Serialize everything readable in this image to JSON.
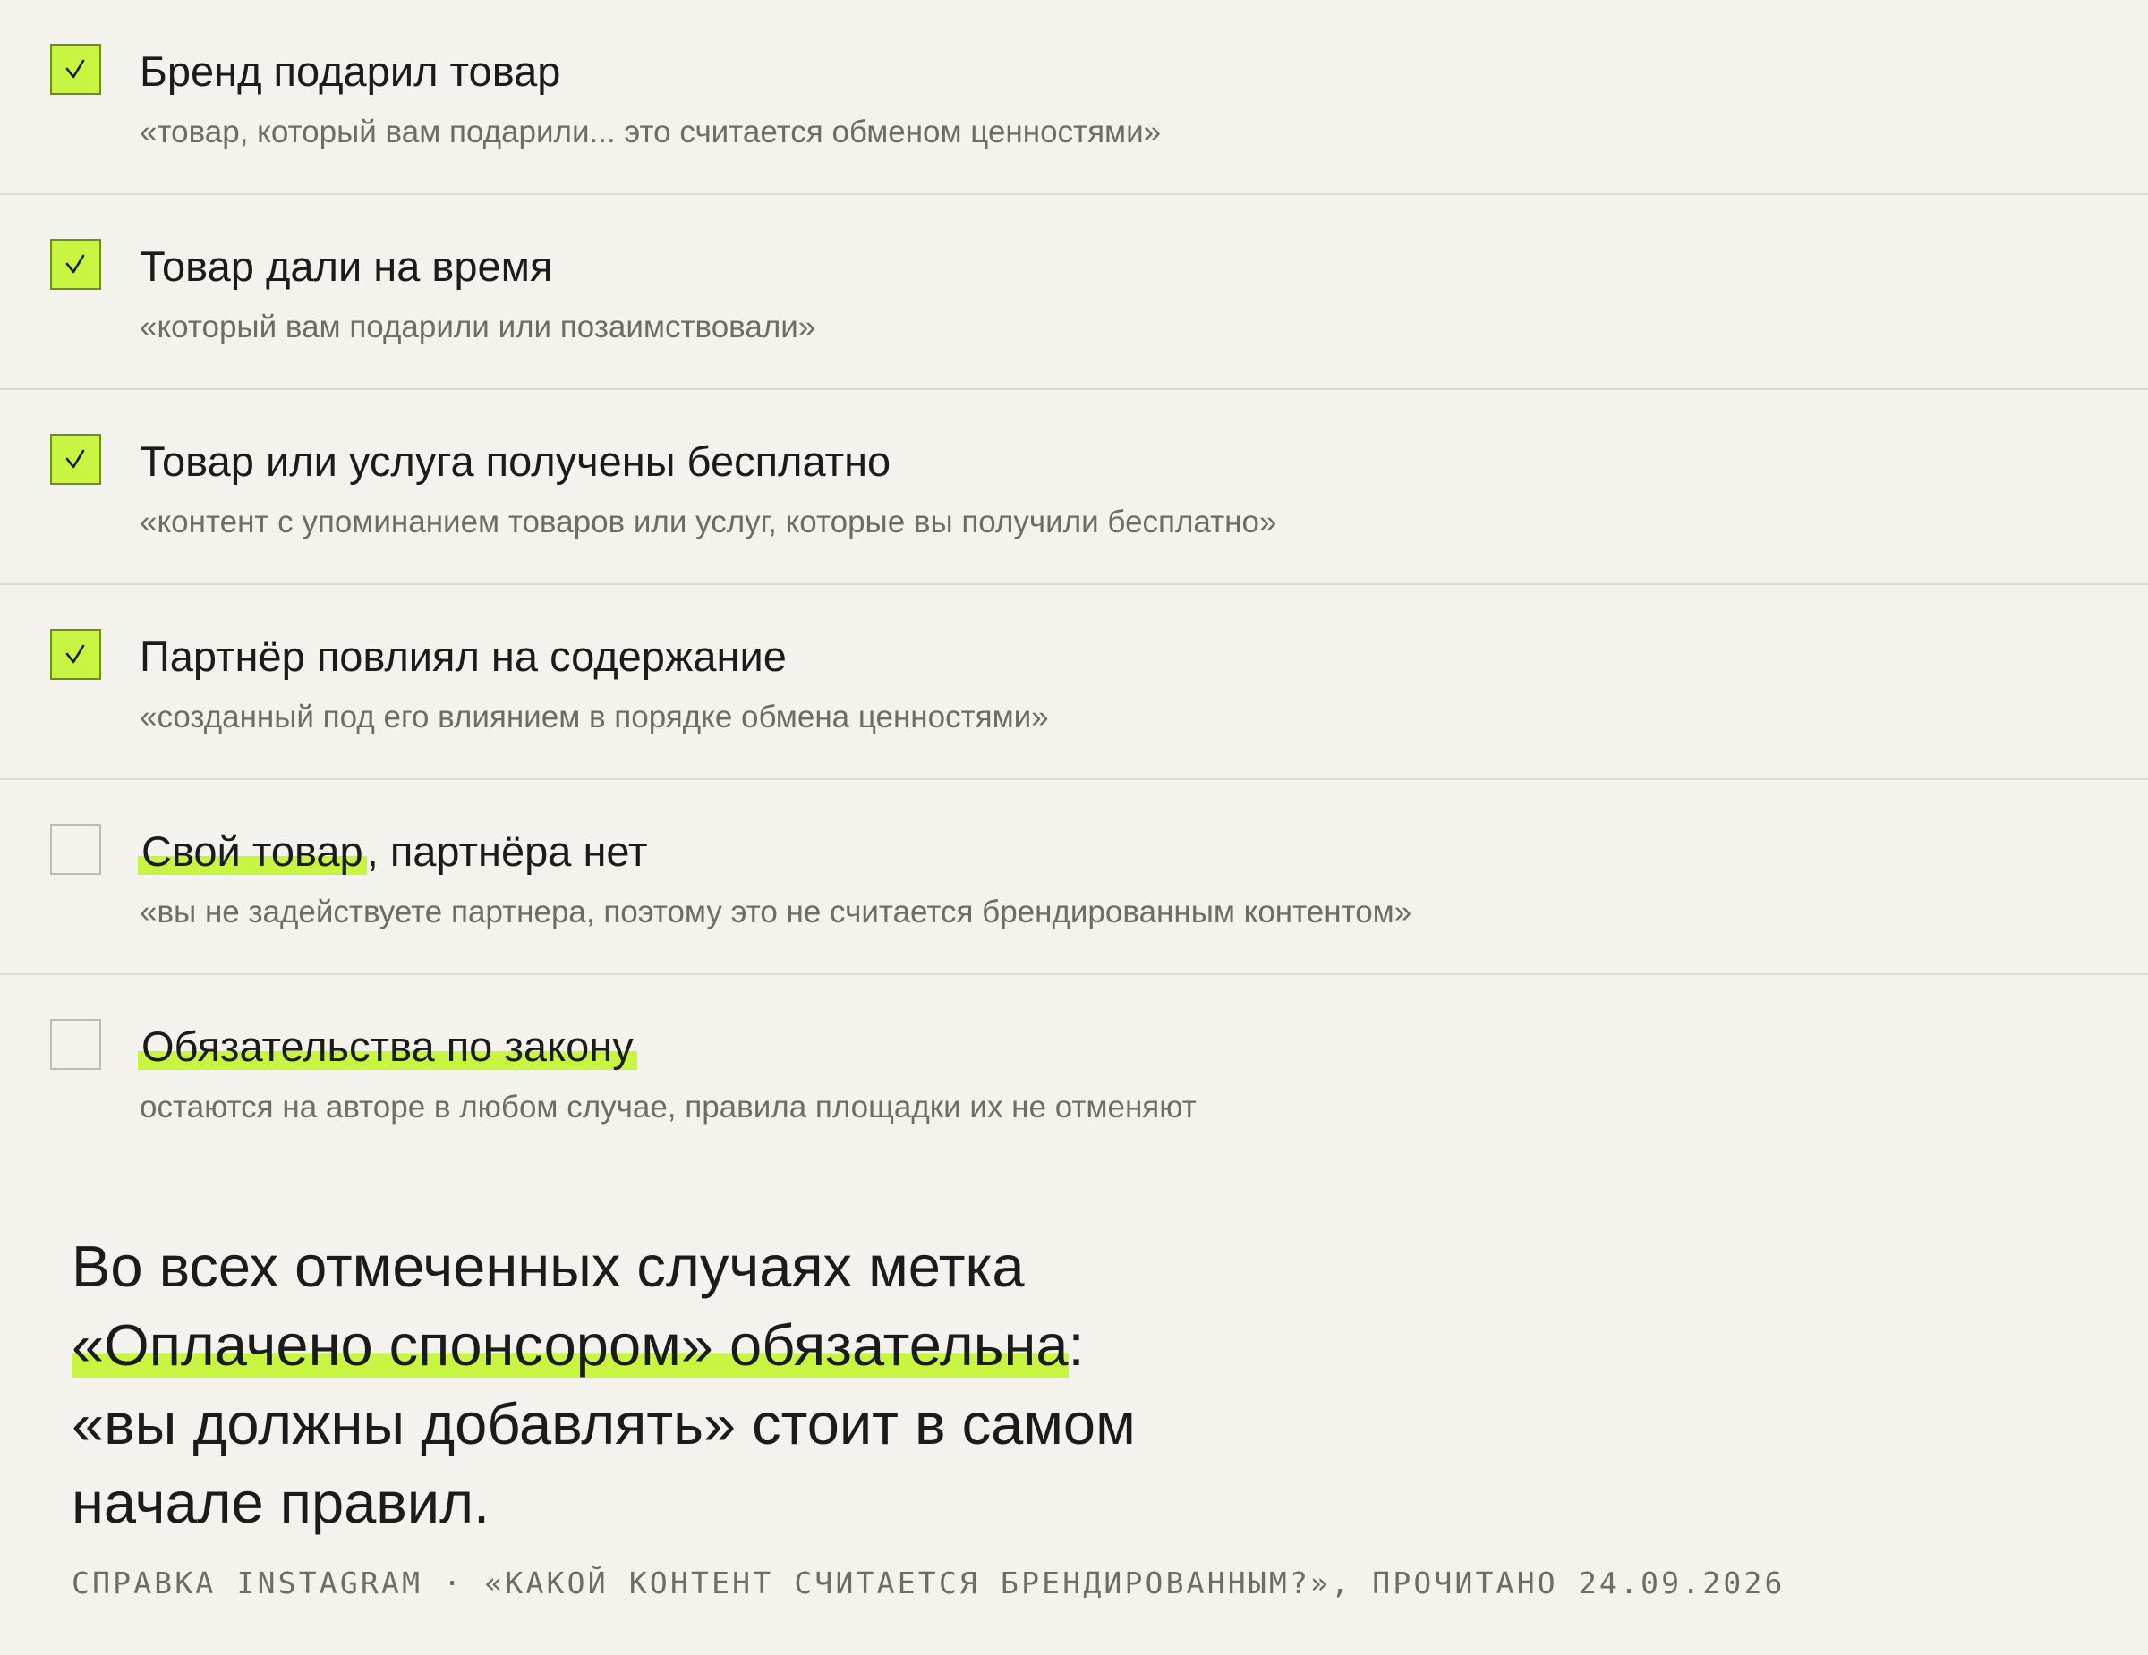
{
  "items": [
    {
      "checked": true,
      "label": "Бренд подарил товар",
      "quote": "«товар, который вам подарили... это считается обменом ценностями»"
    },
    {
      "checked": true,
      "label": "Товар дали на время",
      "quote": "«который вам подарили или позаимствовали»"
    },
    {
      "checked": true,
      "label": "Товар или услуга получены бесплатно",
      "quote": "«контент с упоминанием товаров или услуг, которые вы получили бесплатно»"
    },
    {
      "checked": true,
      "label": "Партнёр повлиял на содержание",
      "quote": "«созданный под его влиянием в порядке обмена ценностями»"
    },
    {
      "checked": false,
      "label_highlight": "Свой товар",
      "label_rest": ", партнёра нет",
      "quote": "«вы не задействуете партнера, поэтому это не считается брендированным контентом»"
    },
    {
      "checked": false,
      "label_highlight": "Обязательства по закону",
      "quote": "остаются на авторе в любом случае, правила площадки их не отменяют"
    }
  ],
  "summary": {
    "line1": "Во всех отмеченных случаях метка",
    "highlight": "«Оплачено спонсором» обязательна",
    "colon": ":",
    "line3": "«вы должны добавлять» стоит в самом",
    "line4": "начале правил."
  },
  "source": "СПРАВКА INSTAGRAM · «КАКОЙ КОНТЕНТ СЧИТАЕТСЯ БРЕНДИРОВАННЫМ?», ПРОЧИТАНО 24.09.2026",
  "colors": {
    "background": "#f4f2ec",
    "accent": "#c8f542",
    "text": "#1b1b1b",
    "muted": "#6e6c68",
    "divider": "#dcdad4"
  }
}
